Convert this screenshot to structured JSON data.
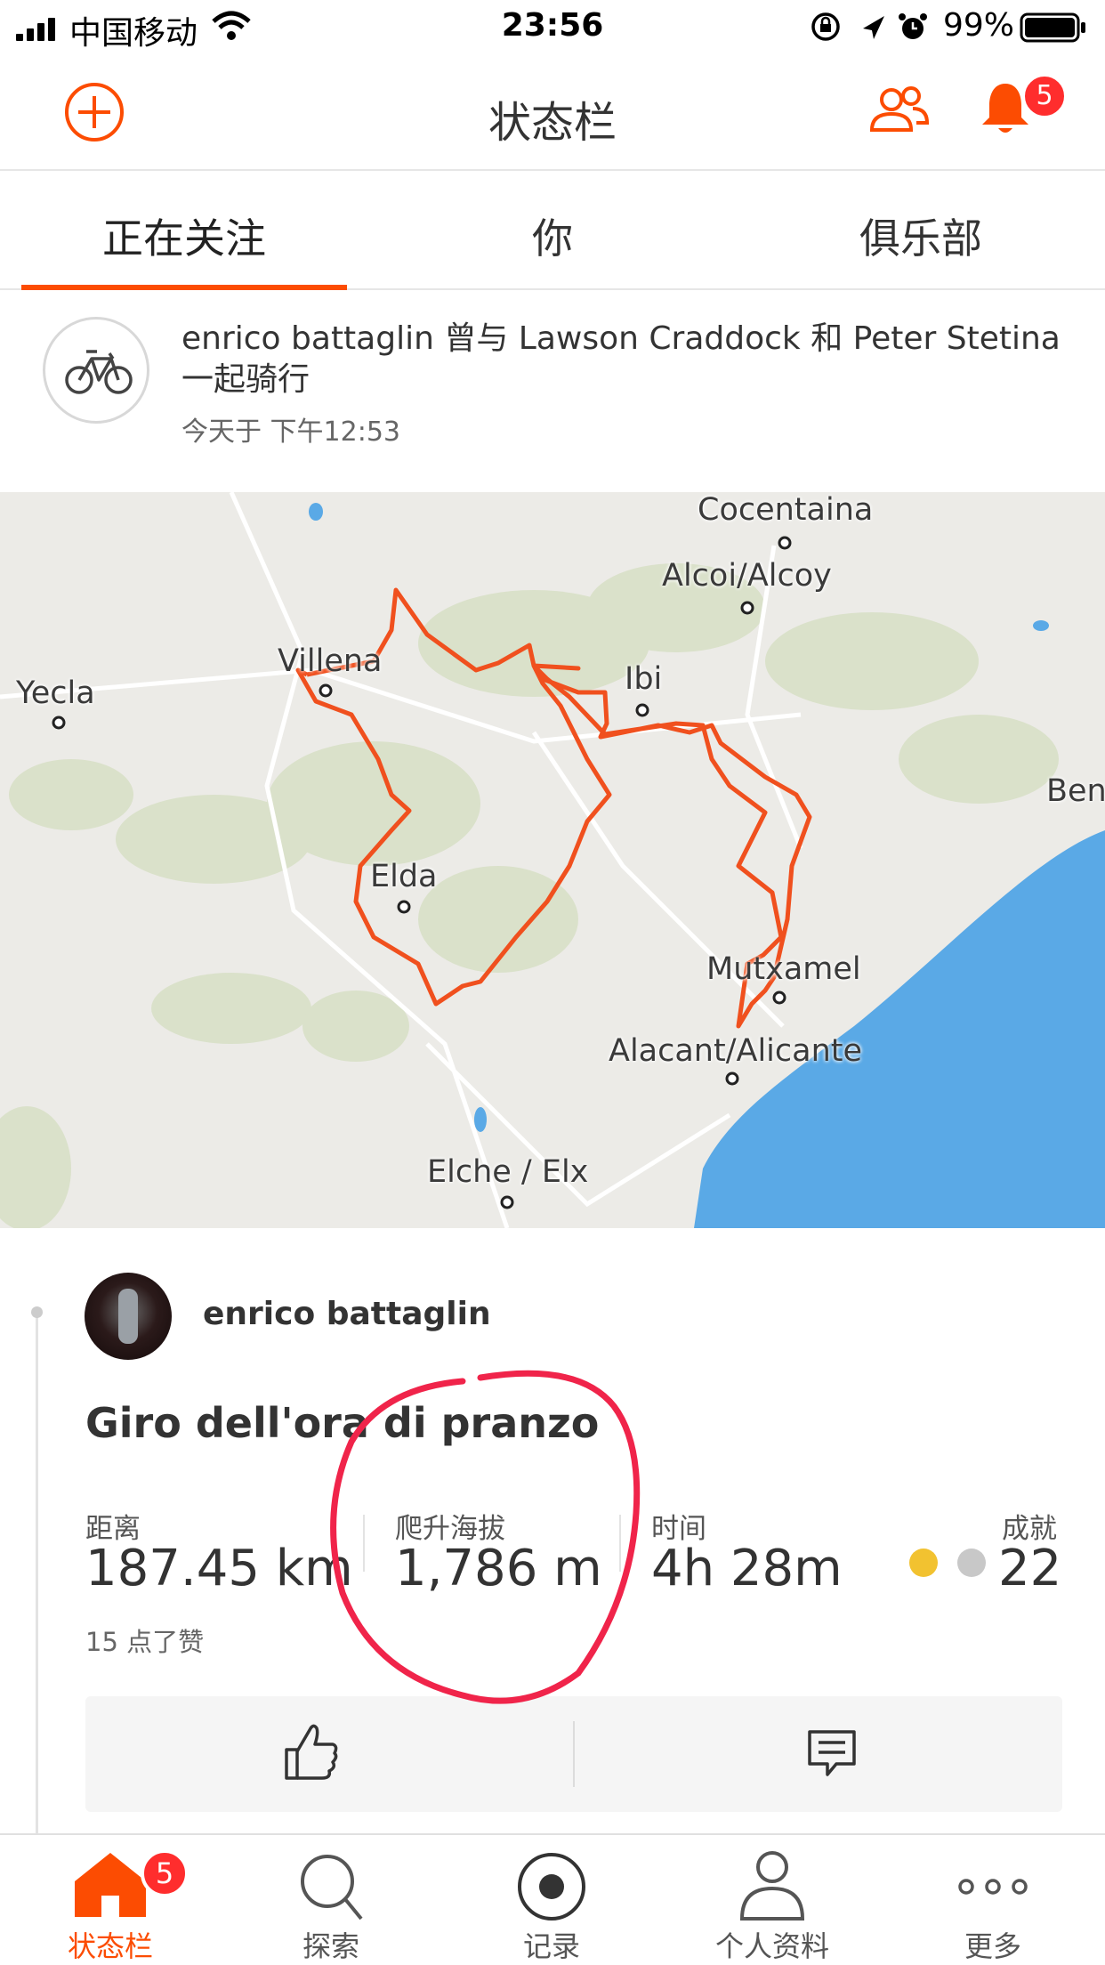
{
  "status_bar": {
    "carrier": "中国移动",
    "time": "23:56",
    "battery": "99%"
  },
  "header": {
    "title": "状态栏",
    "notification_count": "5"
  },
  "tabs": [
    {
      "label": "正在关注",
      "active": true
    },
    {
      "label": "你",
      "active": false
    },
    {
      "label": "俱乐部",
      "active": false
    }
  ],
  "group_activity": {
    "text": "enrico battaglin 曾与 Lawson Craddock 和 Peter Stetina 一起骑行",
    "time": "今天于 下午12:53"
  },
  "map": {
    "places": [
      "Cocentaina",
      "Alcoi/Alcoy",
      "Villena",
      "Yecla",
      "Ibi",
      "Ben",
      "Elda",
      "Mutxamel",
      "Alacant/Alicante",
      "Elche / Elx"
    ],
    "route_color": "#f0501e",
    "sea_color": "#5aa9e6"
  },
  "activity": {
    "athlete": "enrico battaglin",
    "title": "Giro dell'ora di pranzo",
    "stats": [
      {
        "label": "距离",
        "value": "187.45 km"
      },
      {
        "label": "爬升海拔",
        "value": "1,786 m"
      },
      {
        "label": "时间",
        "value": "4h 28m"
      },
      {
        "label": "成就",
        "value": "22"
      }
    ],
    "kudos": "15 点了赞"
  },
  "bottom_nav": {
    "items": [
      {
        "label": "状态栏",
        "active": true
      },
      {
        "label": "探索",
        "active": false
      },
      {
        "label": "记录",
        "active": false
      },
      {
        "label": "个人资料",
        "active": false
      },
      {
        "label": "更多",
        "active": false
      }
    ],
    "badge": "5"
  },
  "colors": {
    "accent": "#fc4c02",
    "badge": "#ff2d2d",
    "annotation": "#f0244a"
  }
}
